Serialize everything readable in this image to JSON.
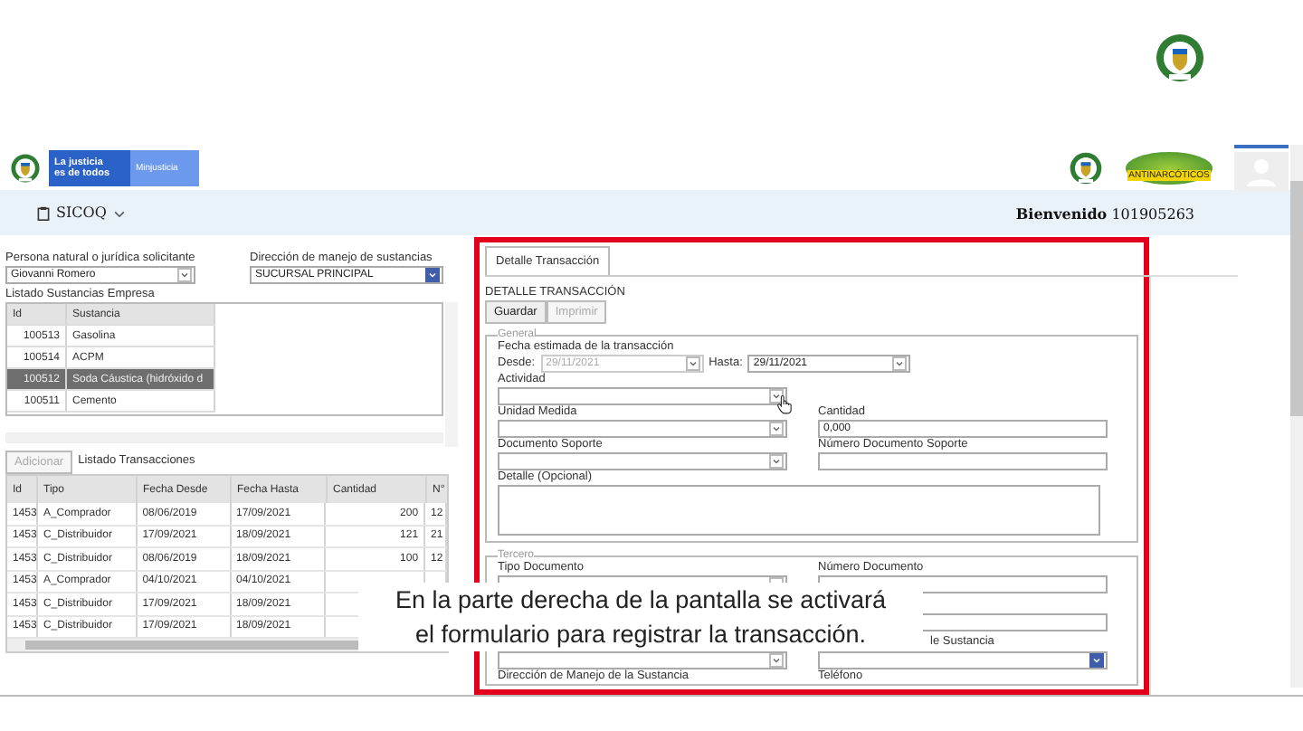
{
  "header": {
    "brand_line1": "La justicia",
    "brand_line2": "es de todos",
    "ministry": "Minjusticia",
    "badge_text": "ANTINARCÓTICOS"
  },
  "nav": {
    "app": "SICOQ",
    "welcome_label": "Bienvenido",
    "user": "101905263"
  },
  "left": {
    "persona_label": "Persona natural o jurídica solicitante",
    "persona_value": "Giovanni Romero",
    "direccion_label": "Dirección de manejo de sustancias",
    "direccion_value": "SUCURSAL PRINCIPAL",
    "substances_title": "Listado Sustancias Empresa",
    "substance_columns": [
      "Id",
      "Sustancia"
    ],
    "substances": [
      {
        "id": "100513",
        "name": "Gasolina",
        "selected": false
      },
      {
        "id": "100514",
        "name": "ACPM",
        "selected": false
      },
      {
        "id": "100512",
        "name": "Soda Cáustica (hidróxido d",
        "selected": true
      },
      {
        "id": "100511",
        "name": "Cemento",
        "selected": false
      }
    ],
    "add_button": {
      "label": "Adicionar",
      "disabled": true
    },
    "transactions_title": "Listado Transacciones",
    "transaction_columns": [
      "Id",
      "Tipo",
      "Fecha Desde",
      "Fecha Hasta",
      "Cantidad",
      "N°"
    ],
    "transactions": [
      {
        "cells": [
          "1453",
          "A_Comprador",
          "08/06/2019",
          "17/09/2021",
          "200",
          "12"
        ]
      },
      {
        "cells": [
          "1453",
          "C_Distribuidor",
          "17/09/2021",
          "18/09/2021",
          "121",
          "21"
        ]
      },
      {
        "cells": [
          "1453",
          "C_Distribuidor",
          "08/06/2019",
          "18/09/2021",
          "100",
          "12"
        ]
      },
      {
        "cells": [
          "1453",
          "A_Comprador",
          "04/10/2021",
          "04/10/2021"
        ]
      },
      {
        "cells": [
          "1453",
          "C_Distribuidor",
          "17/09/2021",
          "18/09/2021"
        ]
      },
      {
        "cells": [
          "1453",
          "C_Distribuidor",
          "17/09/2021",
          "18/09/2021"
        ]
      }
    ]
  },
  "form": {
    "tab": {
      "label": "Detalle Transacción",
      "selected": true
    },
    "title": "DETALLE TRANSACCIÓN",
    "buttons": [
      {
        "label": "Guardar",
        "disabled": false
      },
      {
        "label": "Imprimir",
        "disabled": true
      }
    ],
    "general": {
      "legend": "General",
      "date_label": "Fecha estimada de la transacción",
      "from_label": "Desde:",
      "from_value": "29/11/2021",
      "from_disabled": true,
      "to_label": "Hasta:",
      "to_value": "29/11/2021",
      "actividad_label": "Actividad",
      "unidad_label": "Unidad Medida",
      "cantidad_label": "Cantidad",
      "cantidad_value": "0,000",
      "documento_label": "Documento Soporte",
      "numero_label": "Número Documento Soporte",
      "detalle_label": "Detalle (Opcional)"
    },
    "tercero": {
      "legend": "Tercero",
      "tipo_label": "Tipo Documento",
      "numero_label": "Número Documento",
      "sustancia_label": "le Sustancia",
      "direccion_label": "Dirección de Manejo de la Sustancia",
      "telefono_label": "Teléfono"
    }
  },
  "subtitle": {
    "lines": [
      "En la parte derecha de la pantalla se activará",
      "el formulario para registrar la transacción."
    ]
  }
}
